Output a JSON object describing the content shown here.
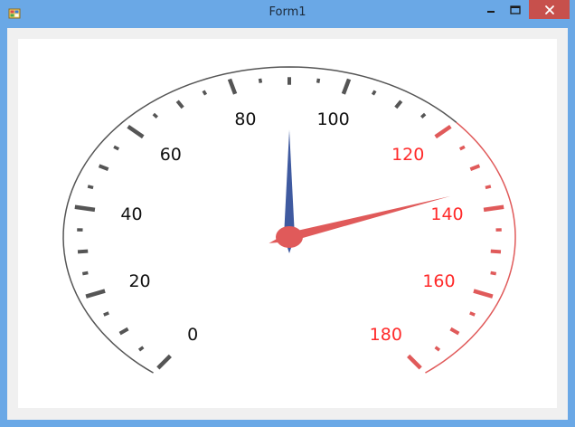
{
  "window": {
    "title": "Form1",
    "colors": {
      "titlebar": "#6aa8e6",
      "close_button": "#c7504c",
      "client": "#f0f0f0",
      "panel": "#ffffff"
    }
  },
  "gauge": {
    "min": 0,
    "max": 180,
    "major_step": 20,
    "danger_start": 120,
    "needle_blue_value": 90,
    "needle_red_value": 134,
    "labels": [
      "0",
      "20",
      "40",
      "60",
      "80",
      "100",
      "120",
      "140",
      "160",
      "180"
    ],
    "colors": {
      "normal": "#555555",
      "danger": "#e05a5a",
      "needle_blue": "#3f5aa0",
      "needle_red": "#e05a5a",
      "label_normal": "#111111",
      "label_danger": "#ff2a2a"
    }
  }
}
